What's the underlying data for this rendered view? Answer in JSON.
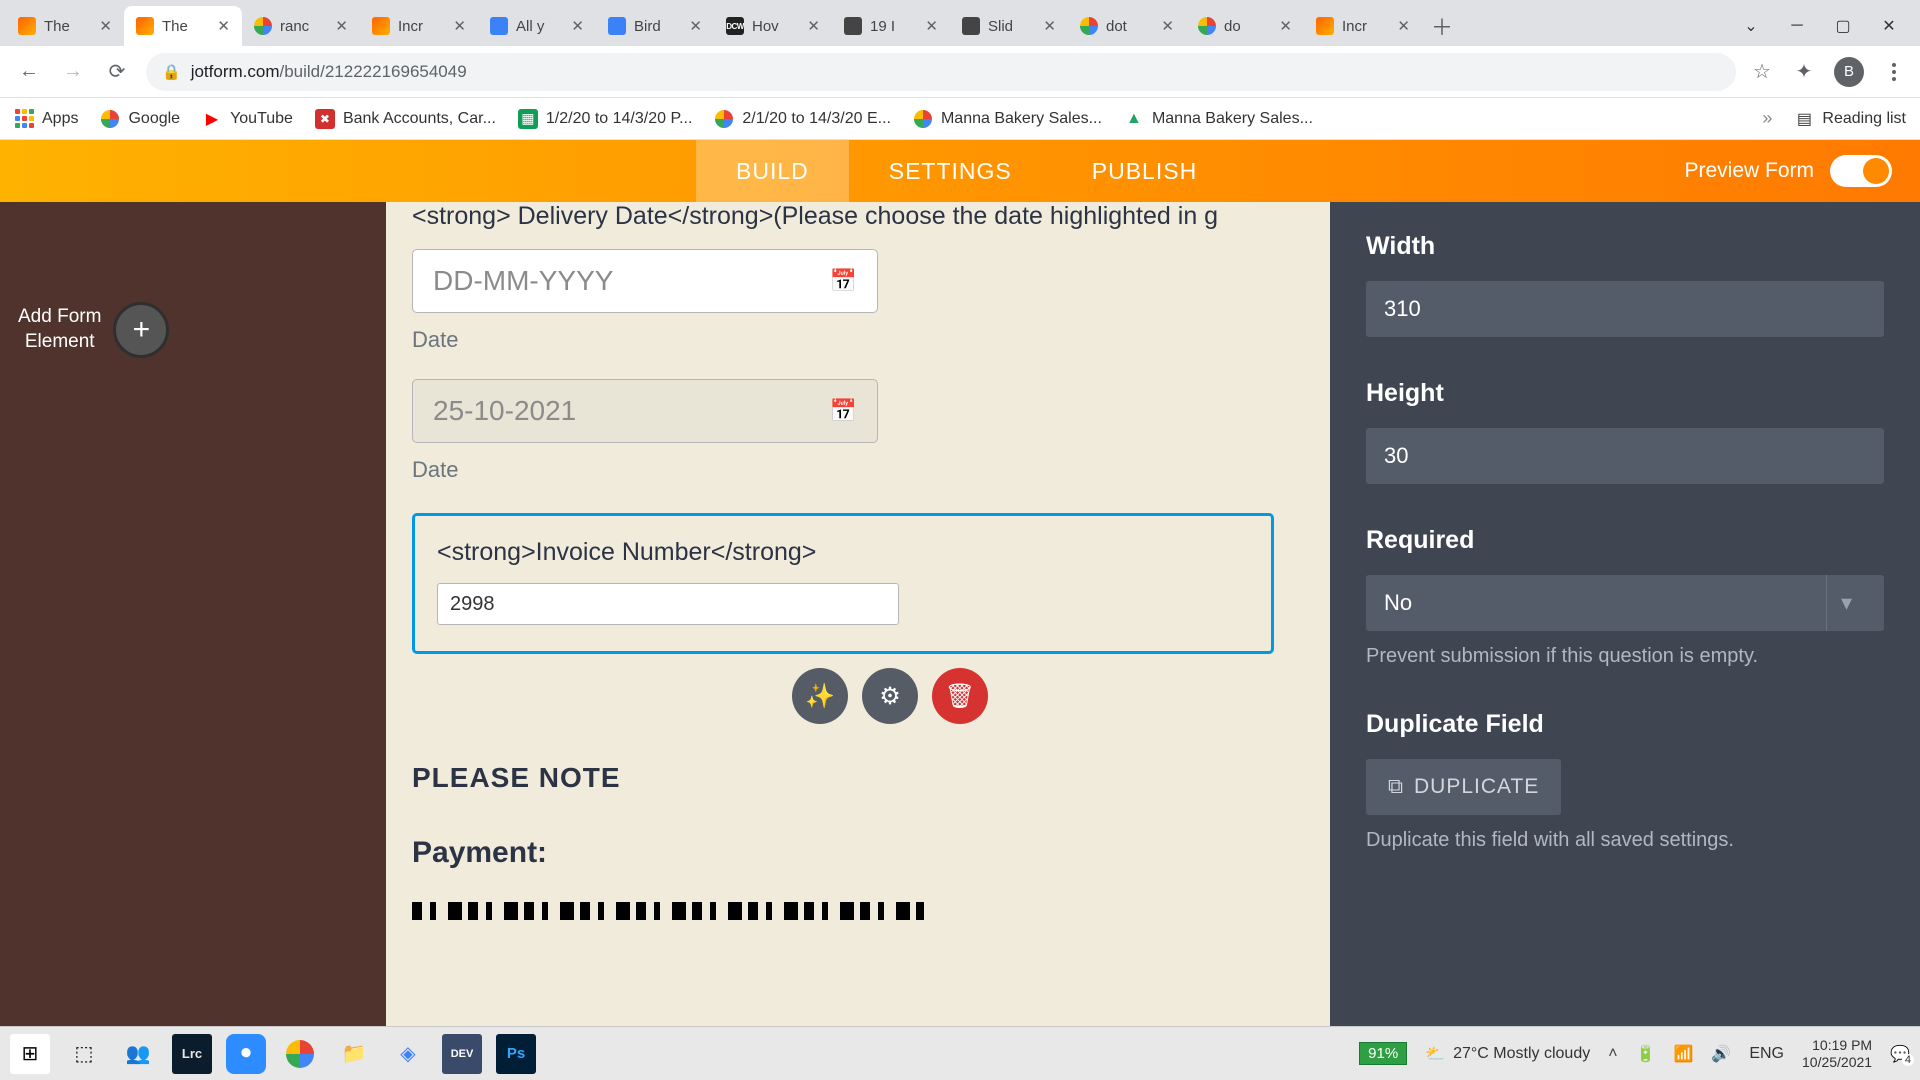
{
  "browser": {
    "tabs": [
      {
        "title": "The",
        "favClass": "fav-jotform"
      },
      {
        "title": "The",
        "favClass": "fav-jotform",
        "active": true
      },
      {
        "title": "ranc",
        "favClass": "fav-google"
      },
      {
        "title": "Incr",
        "favClass": "fav-jotform"
      },
      {
        "title": "All y",
        "favClass": "fav-generic"
      },
      {
        "title": "Bird",
        "favClass": "fav-generic"
      },
      {
        "title": "Hov",
        "favClass": "fav-dcw",
        "favText": "DCW"
      },
      {
        "title": "19 I",
        "favClass": "fav-text"
      },
      {
        "title": "Slid",
        "favClass": "fav-text"
      },
      {
        "title": "dot",
        "favClass": "fav-google"
      },
      {
        "title": "do",
        "favClass": "fav-google"
      },
      {
        "title": "Incr",
        "favClass": "fav-jotform"
      }
    ],
    "url_host": "jotform.com",
    "url_path": "/build/212222169654049",
    "avatar": "B"
  },
  "bookmarks": {
    "items": [
      "Apps",
      "Google",
      "YouTube",
      "Bank Accounts, Car...",
      "1/2/20 to 14/3/20 P...",
      "2/1/20 to 14/3/20 E...",
      "Manna Bakery Sales...",
      "Manna Bakery Sales..."
    ],
    "reading": "Reading list"
  },
  "header": {
    "tabs": [
      "BUILD",
      "SETTINGS",
      "PUBLISH"
    ],
    "preview": "Preview Form"
  },
  "left": {
    "add_line1": "Add Form",
    "add_line2": "Element"
  },
  "form": {
    "delivery_label": "<strong> Delivery Date</strong>(Please choose the date highlighted in g",
    "delivery_placeholder": "DD-MM-YYYY",
    "date_sublabel": "Date",
    "date_value": "25-10-2021",
    "date_sublabel2": "Date",
    "invoice_label": "<strong>Invoice Number</strong>",
    "invoice_value": "2998",
    "note_heading": "PLEASE NOTE",
    "payment_heading": "Payment:"
  },
  "right": {
    "width_label": "Width",
    "width_value": "310",
    "height_label": "Height",
    "height_value": "30",
    "required_label": "Required",
    "required_value": "No",
    "required_help": "Prevent submission if this question is empty.",
    "duplicate_label": "Duplicate Field",
    "duplicate_btn": "DUPLICATE",
    "duplicate_help": "Duplicate this field with all saved settings."
  },
  "taskbar": {
    "battery": "91%",
    "weather": "27°C  Mostly cloudy",
    "lang": "ENG",
    "time": "10:19 PM",
    "date": "10/25/2021",
    "notif": "4"
  }
}
